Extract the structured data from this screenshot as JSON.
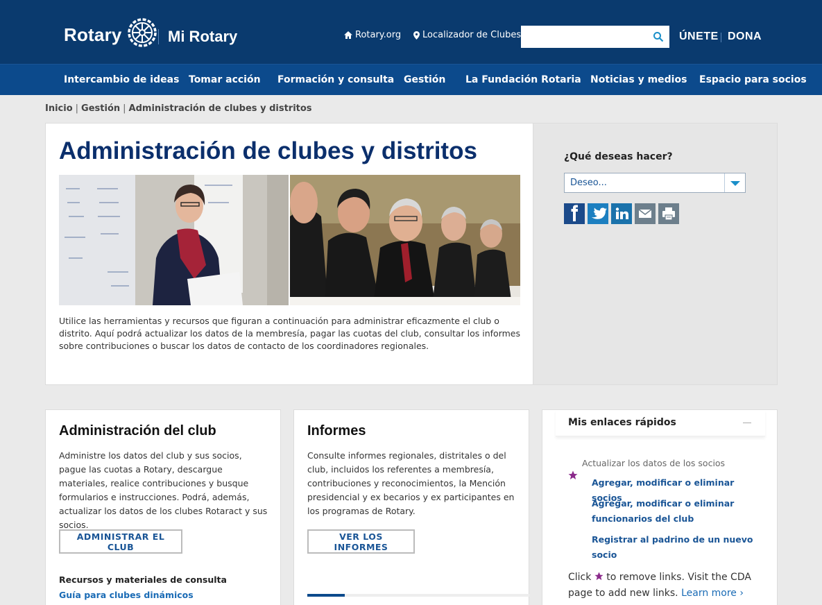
{
  "header": {
    "logo_text": "Rotary",
    "site_name": "Mi Rotary",
    "util_links": [
      {
        "label": "Rotary.org",
        "icon": "home-icon"
      },
      {
        "label": "Localizador de Clubes",
        "icon": "map-pin-icon"
      }
    ],
    "search_placeholder": "",
    "join_label": "ÚNETE",
    "donate_label": "DONA"
  },
  "nav": [
    "Intercambio de ideas",
    "Tomar acción",
    "Formación y consulta",
    "Gestión",
    "La Fundación Rotaria",
    "Noticias y medios",
    "Espacio para socios"
  ],
  "breadcrumb": [
    "Inicio",
    "Gestión",
    "Administración de clubes y distritos"
  ],
  "hero": {
    "title": "Administración de clubes y distritos",
    "text": "Utilice las herramientas y recursos que figuran a continuación para administrar eficazmente el club o distrito. Aquí podrá actualizar los datos de la membresía, pagar las cuotas del club, consultar los informes sobre contribuciones o buscar los datos de contacto de los coordinadores regionales."
  },
  "sidebar": {
    "question": "¿Qué deseas hacer?",
    "select_value": "Deseo...",
    "share_icons": [
      "facebook-icon",
      "twitter-icon",
      "linkedin-icon",
      "email-icon",
      "print-icon"
    ]
  },
  "cards": [
    {
      "title": "Administración del club",
      "text": "Administre los datos del club y sus socios, pague las cuotas a Rotary, descargue materiales, realice contribuciones y busque formularios e instrucciones. Podrá, además, actualizar los datos de los clubes Rotaract y sus socios.",
      "button": "ADMINISTRAR EL CLUB",
      "resources_title": "Recursos y materiales de consulta",
      "resources_link": "Guía para clubes dinámicos"
    },
    {
      "title": "Informes",
      "text": "Consulte informes regionales, distritales o del club, incluidos los referentes a membresía, contribuciones y reconocimientos, la Mención presidencial y ex becarios y ex participantes en los programas de Rotary.",
      "button": "VER LOS INFORMES",
      "progress": 0.17
    }
  ],
  "quick_links": {
    "title": "Mis enlaces rápidos",
    "category": "Actualizar los datos de los socios",
    "links": [
      "Agregar, modificar o eliminar socios",
      "Agregar, modificar o eliminar funcionarios del club",
      "Registrar al padrino de un nuevo socio"
    ],
    "footer_pre": "Click",
    "footer_post": "to remove links. Visit the CDA page to add new links.",
    "learn_more": "Learn more ›"
  },
  "colors": {
    "header_bg": "#0a3a6e",
    "nav_bg": "#0c4a8c",
    "title_blue": "#0b2f6c",
    "link_blue": "#1a5596",
    "star_purple": "#8b2a8b"
  }
}
